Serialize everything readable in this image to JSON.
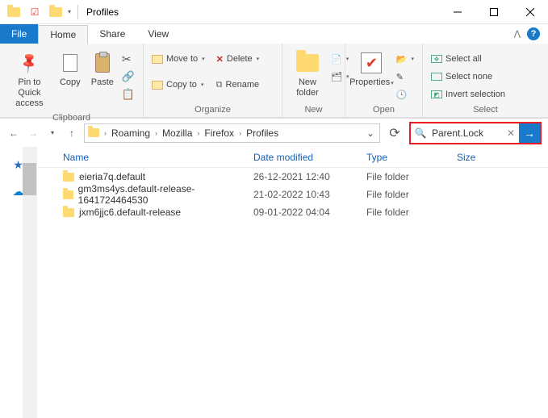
{
  "window": {
    "title": "Profiles"
  },
  "tabs": {
    "file": "File",
    "home": "Home",
    "share": "Share",
    "view": "View"
  },
  "ribbon": {
    "clipboard": {
      "label": "Clipboard",
      "pin": "Pin to Quick\naccess",
      "copy": "Copy",
      "paste": "Paste"
    },
    "organize": {
      "label": "Organize",
      "moveTo": "Move to",
      "copyTo": "Copy to",
      "delete": "Delete",
      "rename": "Rename"
    },
    "new": {
      "label": "New",
      "newFolder": "New\nfolder"
    },
    "open": {
      "label": "Open",
      "properties": "Properties"
    },
    "select": {
      "label": "Select",
      "selectAll": "Select all",
      "selectNone": "Select none",
      "invert": "Invert selection"
    }
  },
  "breadcrumb": {
    "segments": [
      "Roaming",
      "Mozilla",
      "Firefox",
      "Profiles"
    ]
  },
  "search": {
    "value": "Parent.Lock"
  },
  "columns": {
    "name": "Name",
    "date": "Date modified",
    "type": "Type",
    "size": "Size"
  },
  "rows": [
    {
      "name": "eieria7q.default",
      "date": "26-12-2021 12:40",
      "type": "File folder"
    },
    {
      "name": "gm3ms4ys.default-release-1641724464530",
      "date": "21-02-2022 10:43",
      "type": "File folder"
    },
    {
      "name": "jxm6jjc6.default-release",
      "date": "09-01-2022 04:04",
      "type": "File folder"
    }
  ]
}
